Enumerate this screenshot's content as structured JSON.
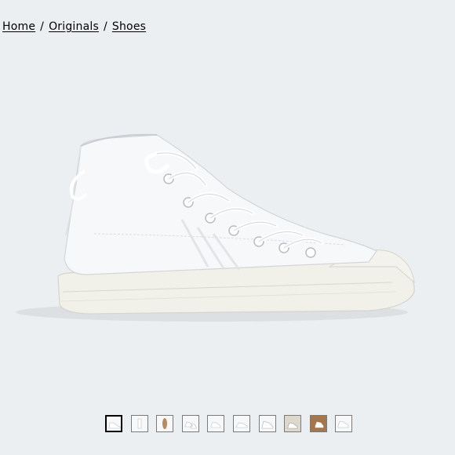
{
  "breadcrumb": {
    "home": "Home",
    "originals": "Originals",
    "shoes": "Shoes",
    "separator": "/"
  },
  "product": {
    "image_icon": "high-top-sneaker-icon",
    "colors": {
      "background": "#eceff1",
      "upper": "#f7f8fa",
      "sole": "#efeee6"
    }
  },
  "gallery": {
    "thumbnail_count": 10,
    "selected_index": 0,
    "thumbnails": [
      {
        "view": "side-view"
      },
      {
        "view": "front-view"
      },
      {
        "view": "sole-view"
      },
      {
        "view": "pair-view"
      },
      {
        "view": "back-view"
      },
      {
        "view": "top-view"
      },
      {
        "view": "detail-view"
      },
      {
        "view": "on-foot-view"
      },
      {
        "view": "box-view"
      },
      {
        "view": "angle-view"
      }
    ]
  }
}
